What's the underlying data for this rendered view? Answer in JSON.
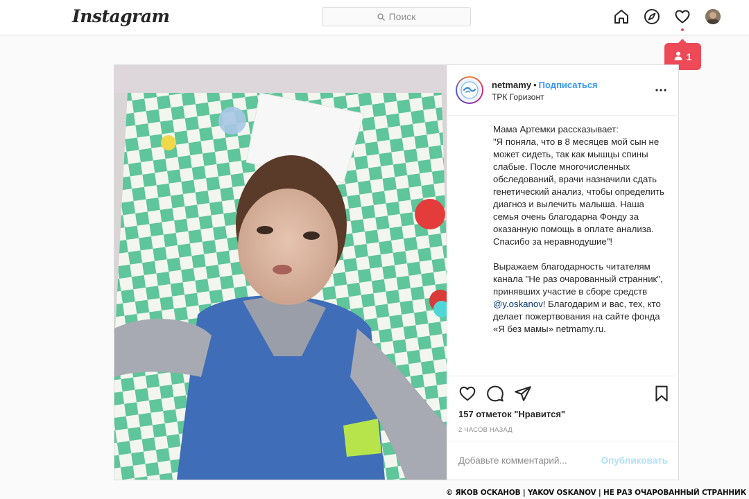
{
  "header": {
    "logo": "Instagram",
    "search_placeholder": "Поиск",
    "icons": [
      "home-icon",
      "explore-icon",
      "activity-heart-icon"
    ],
    "notification_count": "1"
  },
  "post": {
    "username": "netmamy",
    "separator": "•",
    "follow_label": "Подписаться",
    "location": "ТРК Горизонт",
    "caption_before_mention": "Мама Артемки рассказывает:\n\"Я поняла, что в 8 месяцев мой сын не может сидеть, так как мышцы спины слабые. После многочисленных обследований, врачи назначили сдать генетический анализ, чтобы определить диагноз и вылечить малыша. Наша семья очень благодарна Фонду за оказанную помощь в оплате анализа. Спасибо за неравнодушие\"!\n\nВыражаем благодарность читателям канала \"Не раз очарованный странник\", принявших участие в сборе средств ",
    "mention": "@y.oskanov",
    "caption_after_mention": "! Благодарим и вас, тех, кто делает пожертвования на сайте фонда «Я без мамы» netmamy.ru.",
    "likes": "157 отметок \"Нравится\"",
    "time": "2 ЧАСОВ НАЗАД",
    "comment_placeholder": "Добавьте комментарий...",
    "publish_label": "Опубликовать"
  },
  "watermark": "© ЯКОВ ОСКАНОВ  | YAKOV OSKANOV  | НЕ РАЗ ОЧАРОВАННЫЙ СТРАННИК"
}
